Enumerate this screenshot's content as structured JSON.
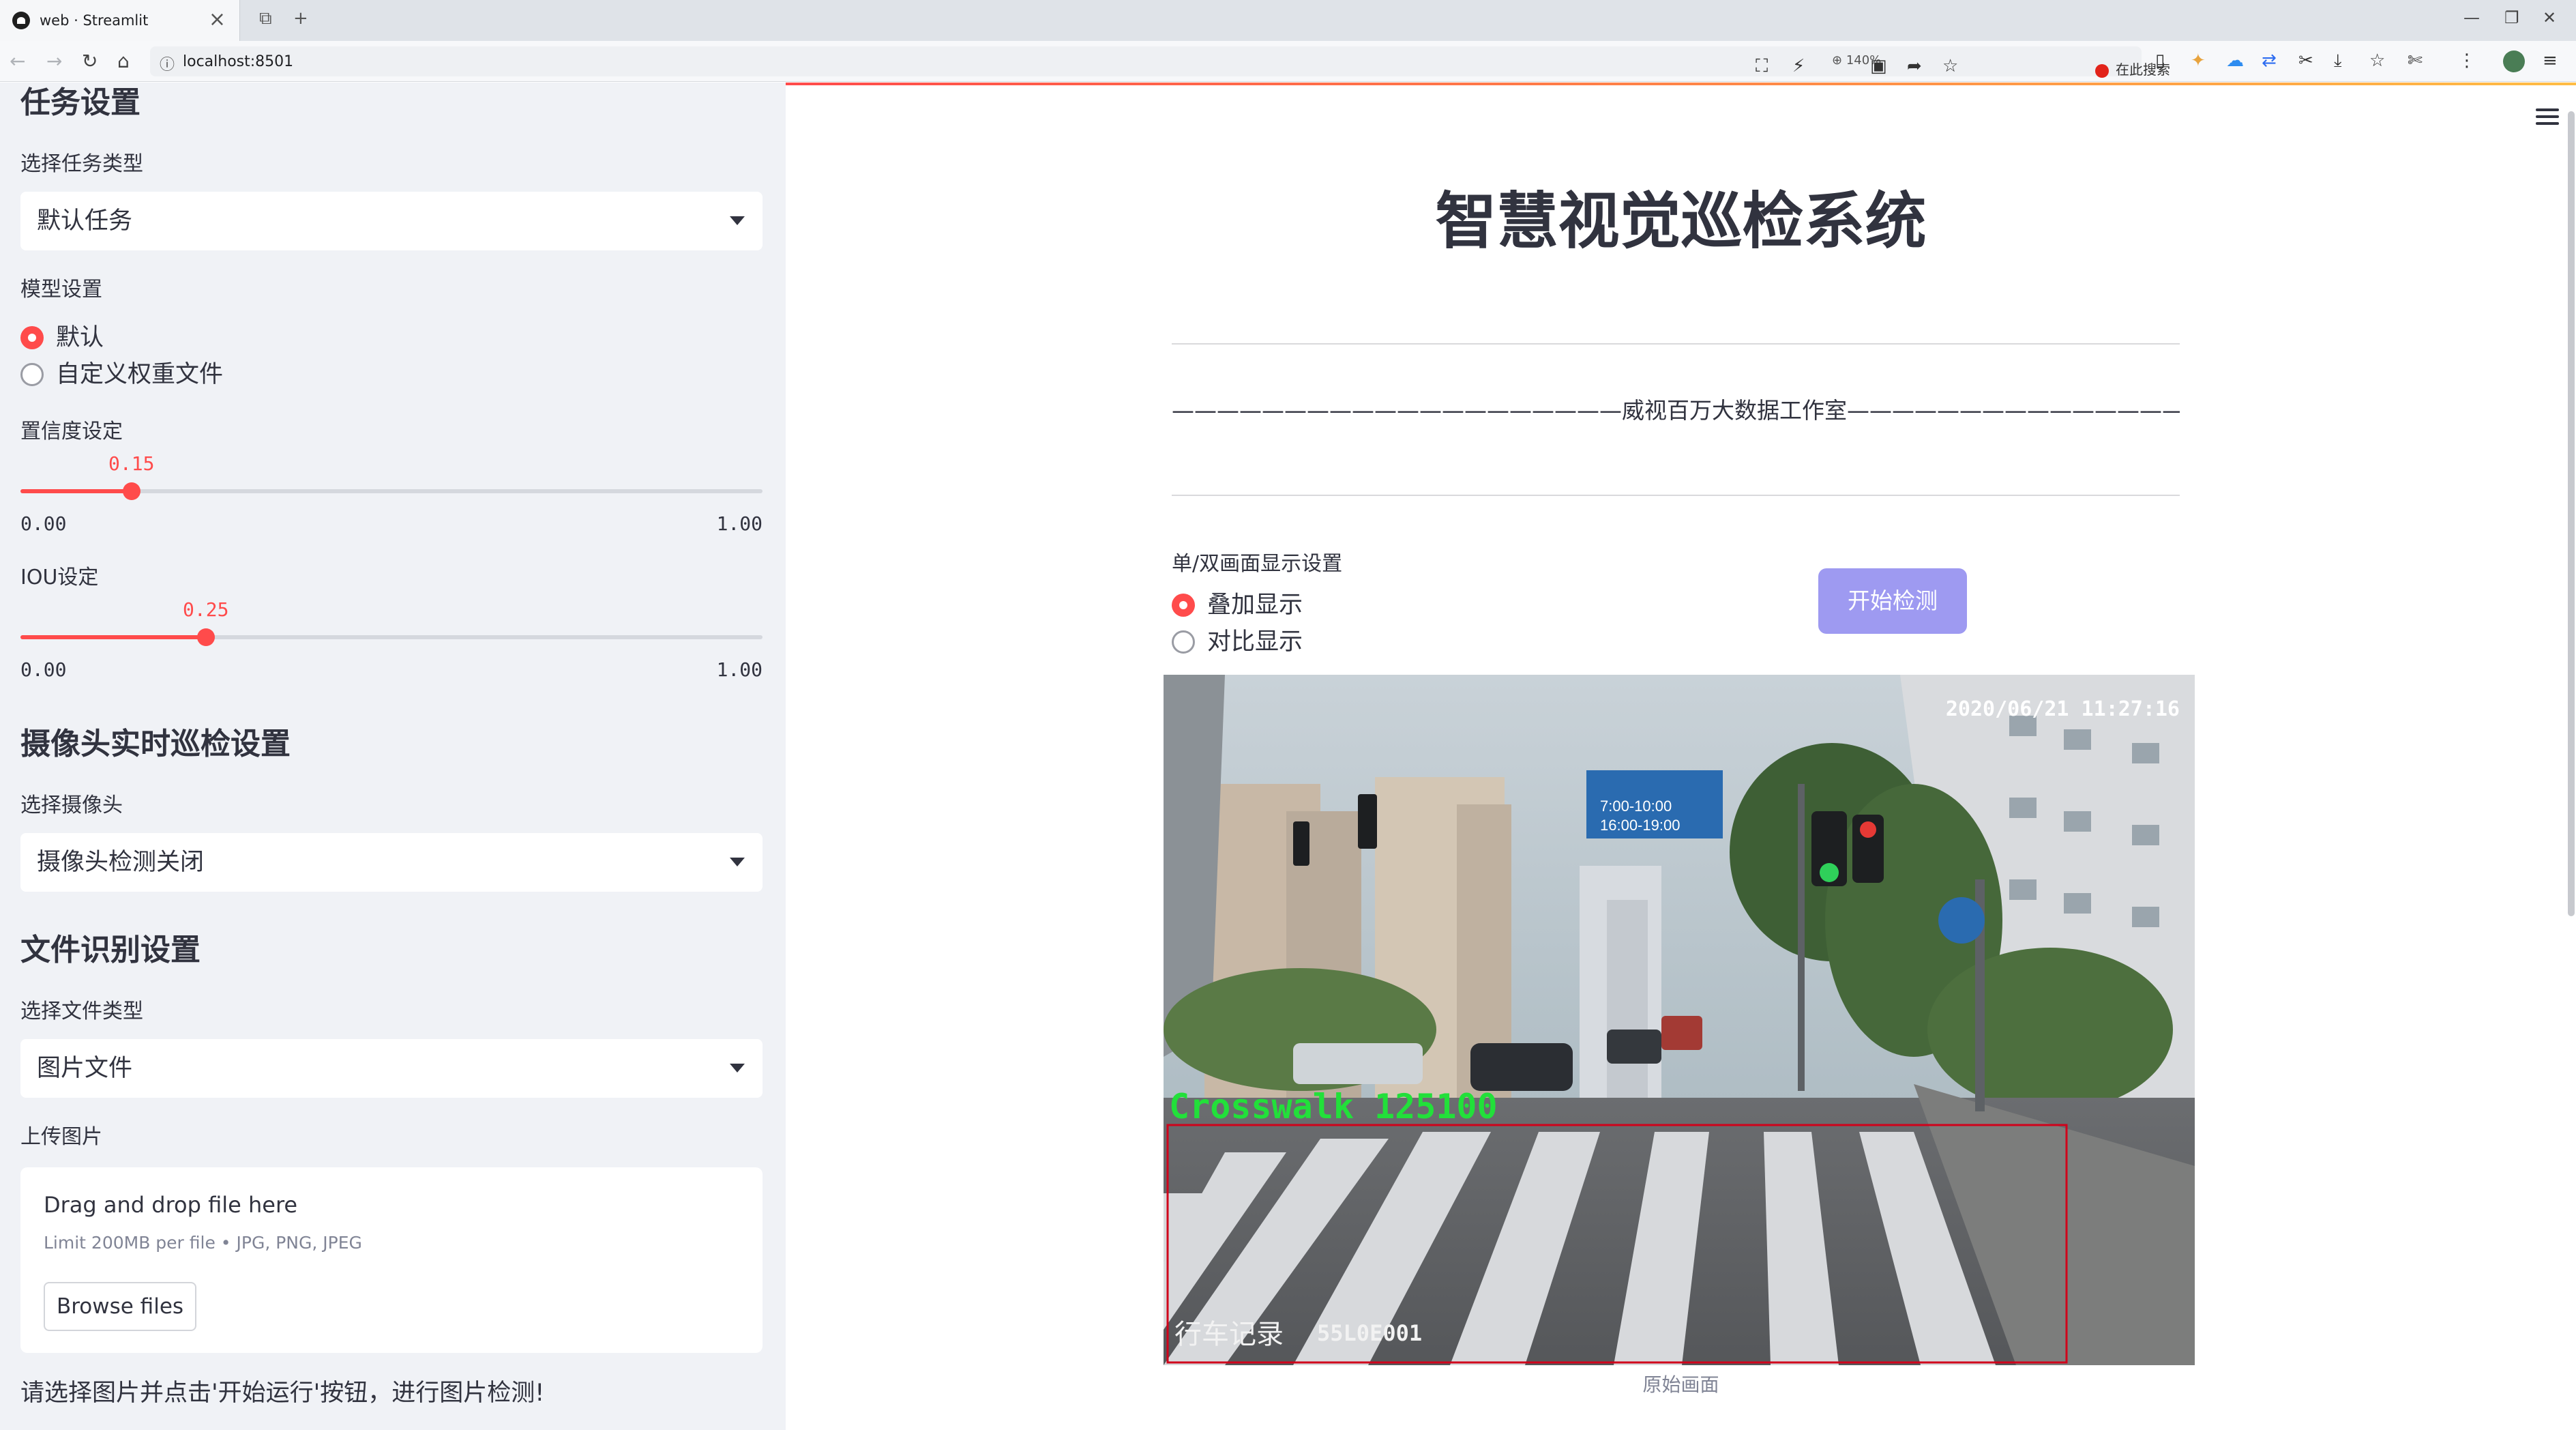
{
  "browser": {
    "tab_title": "web · Streamlit",
    "url": "localhost:8501",
    "zoom": "140%",
    "search_placeholder": "在此搜索"
  },
  "sidebar": {
    "task_section": {
      "title": "任务设置",
      "task_type_label": "选择任务类型",
      "task_type_value": "默认任务"
    },
    "model_section": {
      "label": "模型设置",
      "options": [
        "默认",
        "自定义权重文件"
      ],
      "selected": "默认"
    },
    "confidence": {
      "label": "置信度设定",
      "value": "0.15",
      "min": "0.00",
      "max": "1.00",
      "fraction": 0.15
    },
    "iou": {
      "label": "IOU设定",
      "value": "0.25",
      "min": "0.00",
      "max": "1.00",
      "fraction": 0.25
    },
    "camera_section": {
      "title": "摄像头实时巡检设置",
      "camera_label": "选择摄像头",
      "camera_value": "摄像头检测关闭"
    },
    "file_section": {
      "title": "文件识别设置",
      "file_type_label": "选择文件类型",
      "file_type_value": "图片文件",
      "upload_label": "上传图片"
    },
    "uploader": {
      "title": "Drag and drop file here",
      "limit": "Limit 200MB per file • JPG, PNG, JPEG",
      "browse_label": "Browse files"
    },
    "note": "请选择图片并点击'开始运行'按钮，进行图片检测!"
  },
  "main": {
    "title": "智慧视觉巡检系统",
    "studio_line": "————————————————————威视百万大数据工作室—————————————————————",
    "display_label": "单/双画面显示设置",
    "display_options": [
      "叠加显示",
      "对比显示"
    ],
    "display_selected": "叠加显示",
    "start_button": "开始检测",
    "frame": {
      "timestamp": "2020/06/21 11:27:16",
      "detection_label": "Crosswalk 125100",
      "overlay_left": "行车记录",
      "overlay_code": "55L0E001",
      "sign_text_1": "7:00-10:00",
      "sign_text_2": "16:00-19:00",
      "caption": "原始画面"
    }
  },
  "colors": {
    "accent": "#ff4b4b",
    "button": "#9e9af1",
    "detection_box": "#d0021b",
    "detection_text": "#22e03a"
  }
}
